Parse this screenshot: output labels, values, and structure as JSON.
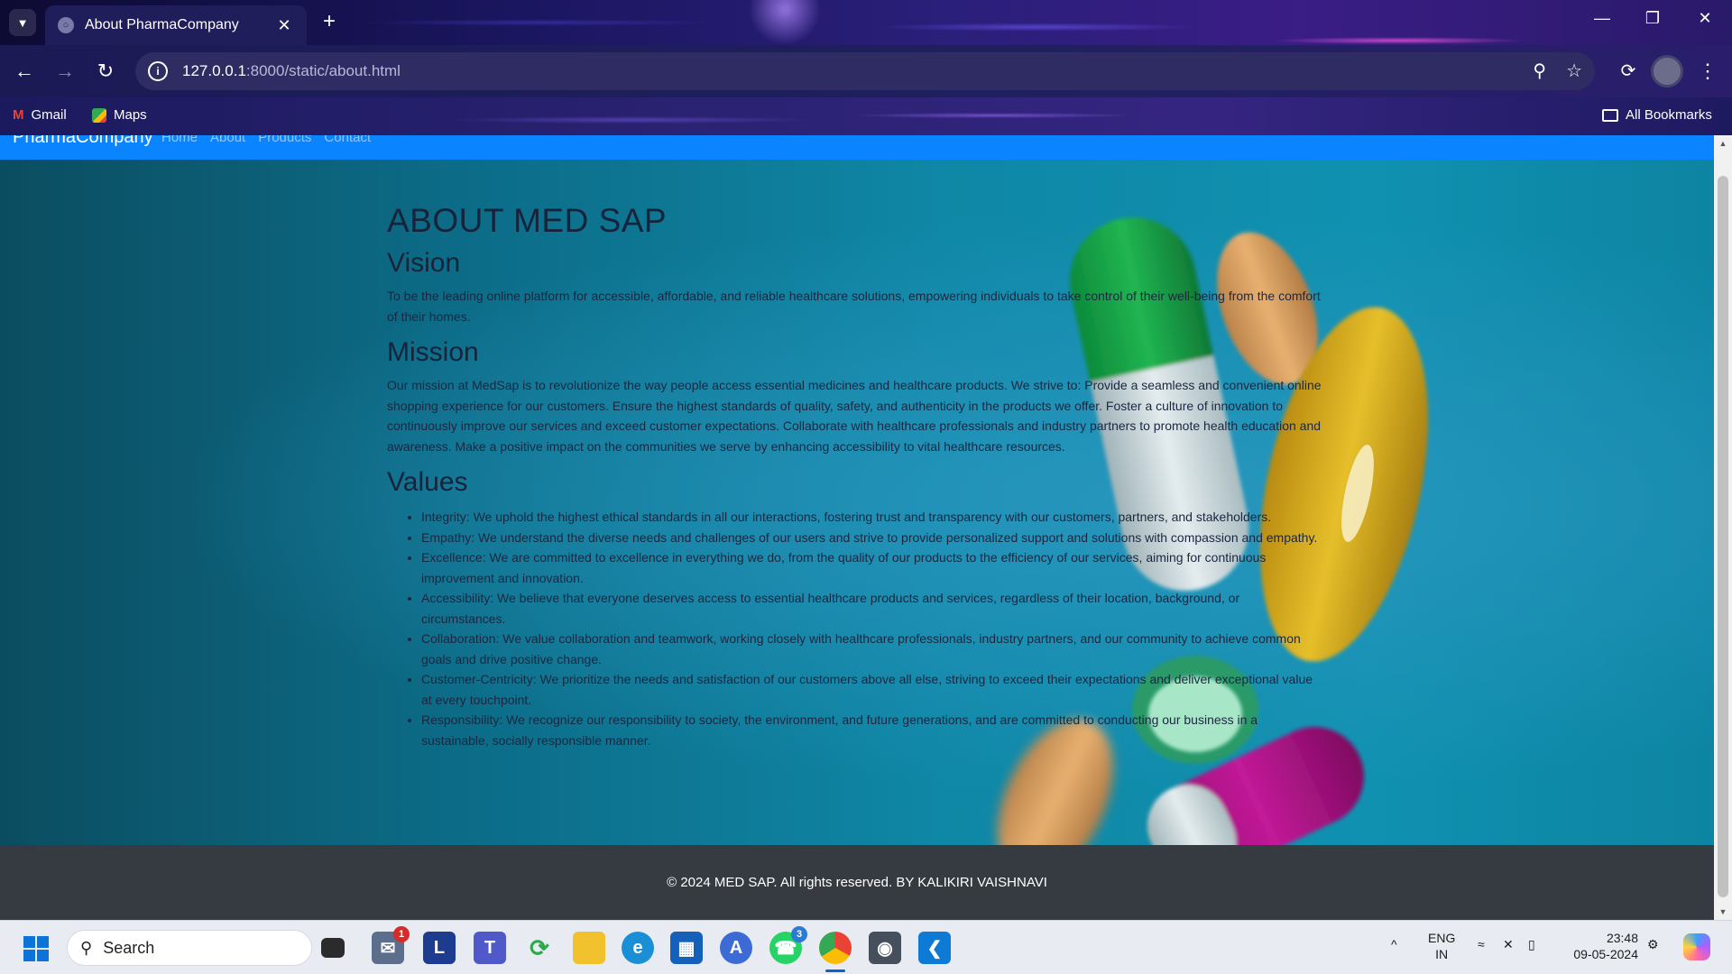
{
  "browser": {
    "tab_title": "About PharmaCompany",
    "url_host": "127.0.0.1",
    "url_path": ":8000/static/about.html",
    "bookmarks": [
      {
        "label": "Gmail",
        "icon": "gmail-icon"
      },
      {
        "label": "Maps",
        "icon": "maps-icon"
      }
    ],
    "all_bookmarks_label": "All Bookmarks"
  },
  "site": {
    "brand": "PharmaCompany",
    "nav": [
      "Home",
      "About",
      "Products",
      "Contact"
    ],
    "nav_color": "#0a84ff"
  },
  "about": {
    "title": "ABOUT MED SAP",
    "vision_heading": "Vision",
    "vision_text": "To be the leading online platform for accessible, affordable, and reliable healthcare solutions, empowering individuals to take control of their well-being from the comfort of their homes.",
    "mission_heading": "Mission",
    "mission_text": "Our mission at MedSap is to revolutionize the way people access essential medicines and healthcare products. We strive to: Provide a seamless and convenient online shopping experience for our customers. Ensure the highest standards of quality, safety, and authenticity in the products we offer. Foster a culture of innovation to continuously improve our services and exceed customer expectations. Collaborate with healthcare professionals and industry partners to promote health education and awareness. Make a positive impact on the communities we serve by enhancing accessibility to vital healthcare resources.",
    "values_heading": "Values",
    "values": [
      "Integrity: We uphold the highest ethical standards in all our interactions, fostering trust and transparency with our customers, partners, and stakeholders.",
      "Empathy: We understand the diverse needs and challenges of our users and strive to provide personalized support and solutions with compassion and empathy.",
      "Excellence: We are committed to excellence in everything we do, from the quality of our products to the efficiency of our services, aiming for continuous improvement and innovation.",
      "Accessibility: We believe that everyone deserves access to essential healthcare products and services, regardless of their location, background, or circumstances.",
      "Collaboration: We value collaboration and teamwork, working closely with healthcare professionals, industry partners, and our community to achieve common goals and drive positive change.",
      "Customer-Centricity: We prioritize the needs and satisfaction of our customers above all else, striving to exceed their expectations and deliver exceptional value at every touchpoint.",
      "Responsibility: We recognize our responsibility to society, the environment, and future generations, and are committed to conducting our business in a sustainable, socially responsible manner."
    ]
  },
  "footer": {
    "text": "© 2024 MED SAP. All rights reserved. BY KALIKIRI VAISHNAVI",
    "bg": "#353b41"
  },
  "taskbar": {
    "search_placeholder": "Search",
    "apps": [
      {
        "name": "task-view-icon"
      },
      {
        "name": "mail-icon",
        "badge": "1"
      },
      {
        "name": "l-app-icon",
        "glyph": "L"
      },
      {
        "name": "teams-icon"
      },
      {
        "name": "sync-app-icon"
      },
      {
        "name": "file-explorer-icon"
      },
      {
        "name": "edge-icon"
      },
      {
        "name": "store-icon"
      },
      {
        "name": "affinity-icon"
      },
      {
        "name": "whatsapp-icon",
        "badge": "3"
      },
      {
        "name": "chrome-icon"
      },
      {
        "name": "camera-icon"
      },
      {
        "name": "vscode-icon"
      }
    ],
    "lang_top": "ENG",
    "lang_bottom": "IN",
    "time": "23:48",
    "date": "09-05-2024"
  }
}
